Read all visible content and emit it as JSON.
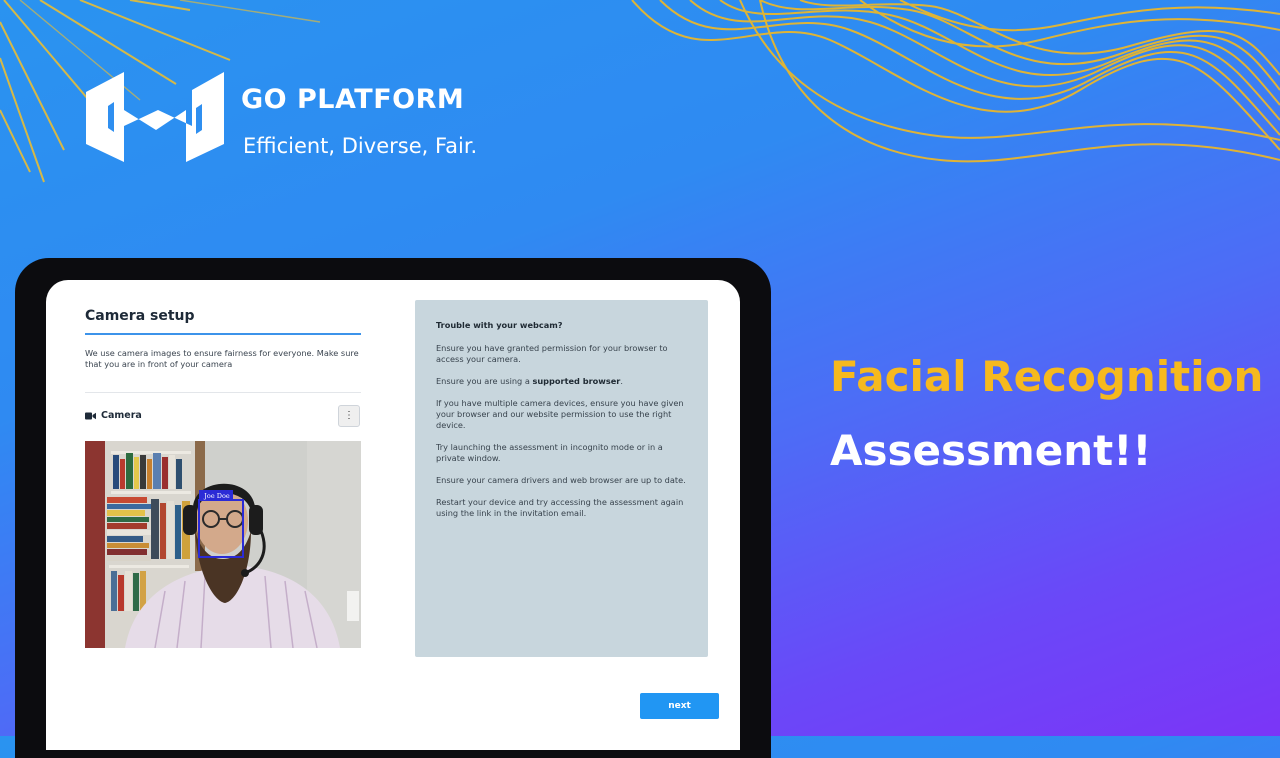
{
  "brand": {
    "name": "GO PLATFORM",
    "tagline": "Efficient, Diverse, Fair."
  },
  "headline": {
    "line1": "Facial Recognition",
    "line2": "Assessment!!"
  },
  "setup": {
    "title": "Camera setup",
    "intro": "We use camera images to ensure fairness for everyone. Make sure that you are in front of your camera",
    "camera_label": "Camera",
    "menu_glyph": "⋮",
    "face_tag": "Joe Doe",
    "next_label": "next"
  },
  "help": {
    "heading": "Trouble with your webcam?",
    "tip1": "Ensure you have granted permission for your browser to access your camera.",
    "tip2_prefix": "Ensure you are using a ",
    "tip2_bold": "supported browser",
    "tip2_suffix": ".",
    "tip3": "If you have multiple camera devices, ensure you have given your browser and our website permission to use the right device.",
    "tip4": "Try launching the assessment in incognito mode or in a private window.",
    "tip5": "Ensure your camera drivers and web browser are up to date.",
    "tip6": "Restart your device and try accessing the assessment again using the link in the invitation email."
  },
  "colors": {
    "accent_blue": "#2196f3",
    "headline_yellow": "#f6b91e",
    "panel_gray": "#c8d6dd",
    "face_box": "#2b2bd6"
  },
  "icons": {
    "logo": "go-platform-logo",
    "camera": "video-camera-icon",
    "menu": "kebab-menu-icon"
  }
}
